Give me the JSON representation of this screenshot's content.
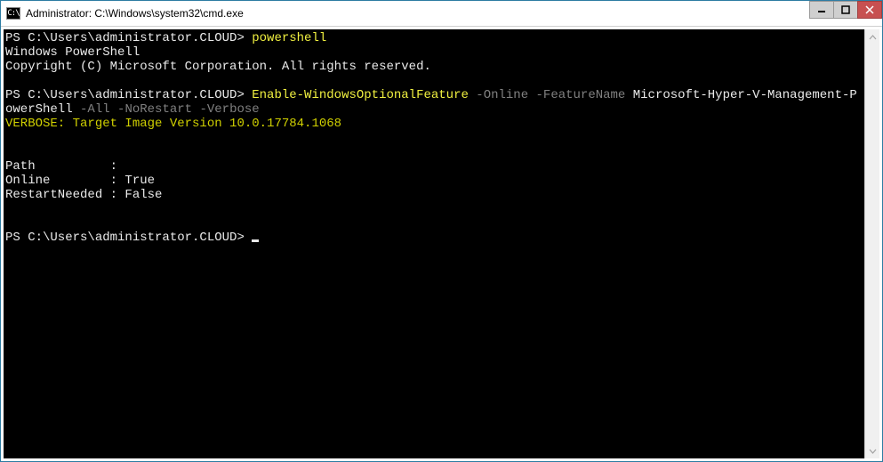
{
  "title": "Administrator: C:\\Windows\\system32\\cmd.exe",
  "prompt": "PS C:\\Users\\administrator.CLOUD>",
  "cmd1": "powershell",
  "banner_line1": "Windows PowerShell",
  "banner_line2": "Copyright (C) Microsoft Corporation. All rights reserved.",
  "cmd2_cmdlet": "Enable-WindowsOptionalFeature",
  "cmd2_p_online": "-Online",
  "cmd2_p_fname": "-FeatureName",
  "cmd2_arg_feature": "Microsoft-Hyper-V-Management-PowerShell",
  "cmd2_p_all": "-All",
  "cmd2_p_norestart": "-NoRestart",
  "cmd2_p_verbose": "-Verbose",
  "verbose_line": "VERBOSE: Target Image Version 10.0.17784.1068",
  "out_path_label": "Path          :",
  "out_online_label": "Online        : ",
  "out_online_value": "True",
  "out_restart_label": "RestartNeeded : ",
  "out_restart_value": "False"
}
